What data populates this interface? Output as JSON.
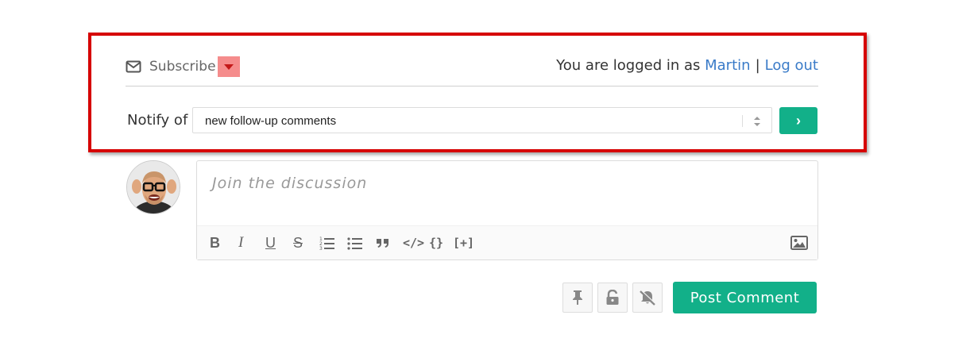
{
  "subscribe": {
    "label": "Subscribe",
    "logged_in_text": "You are logged in as",
    "username": "Martin",
    "separator": "|",
    "logout_label": "Log out"
  },
  "notify": {
    "label": "Notify of",
    "selected": "new follow-up comments",
    "submit_label": "›"
  },
  "editor": {
    "placeholder": "Join the discussion",
    "toolbar": {
      "bold": "B",
      "italic": "I",
      "underline": "U",
      "strike": "S",
      "code": "</>",
      "braces": "{}",
      "spoiler": "[+]"
    }
  },
  "actions": {
    "post_label": "Post Comment"
  },
  "colors": {
    "accent": "#12b089",
    "link": "#3a7bc8",
    "highlight_border": "#d60000",
    "caret_bg": "#f58c8c"
  }
}
